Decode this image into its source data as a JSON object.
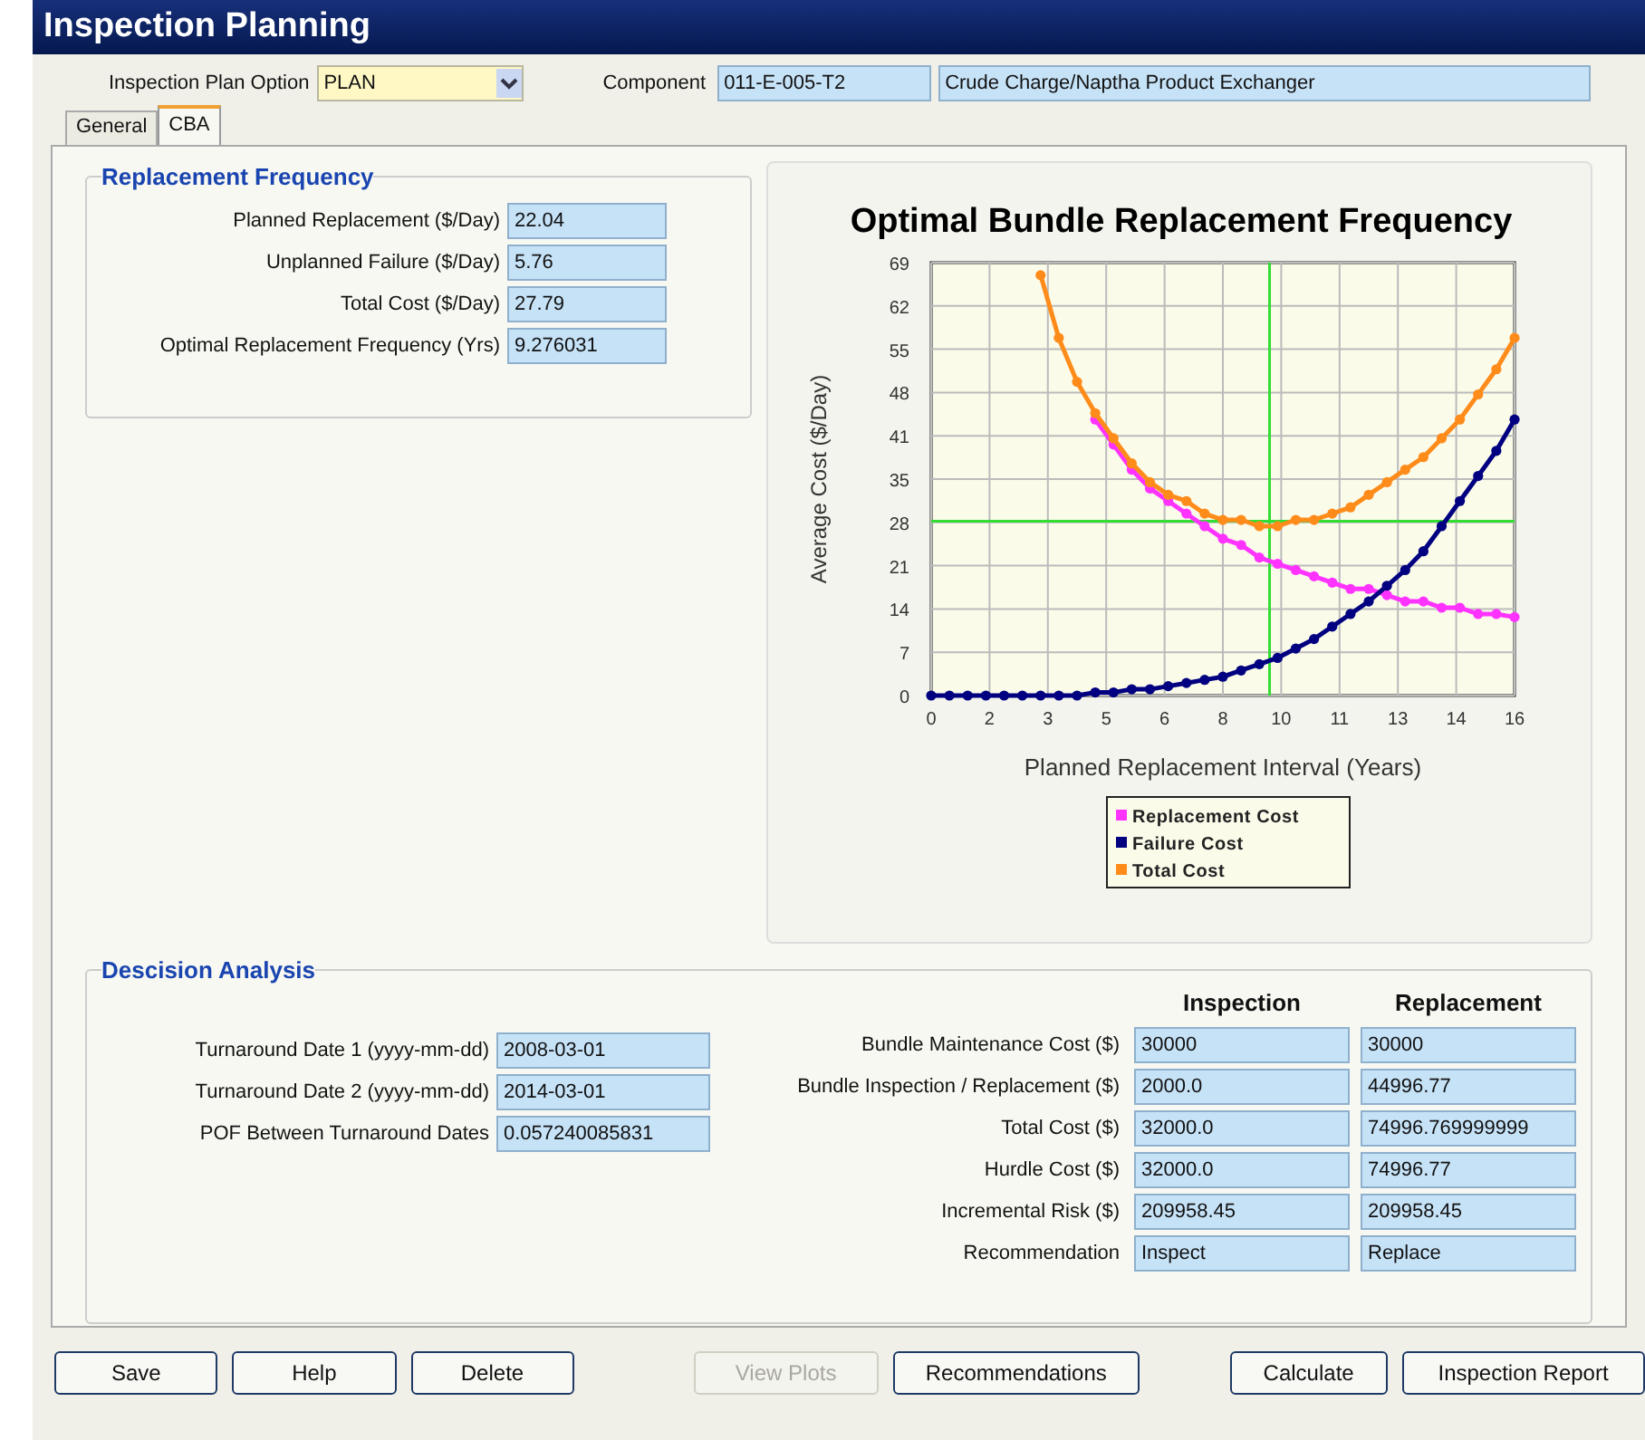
{
  "window": {
    "title": "Inspection Planning"
  },
  "header": {
    "plan_option": {
      "label": "Inspection Plan Option",
      "value": "PLAN"
    },
    "component": {
      "label": "Component",
      "code": "011-E-005-T2",
      "description": "Crude Charge/Naptha Product Exchanger"
    }
  },
  "tabs": [
    {
      "label": "General",
      "selected": false
    },
    {
      "label": "CBA",
      "selected": true
    }
  ],
  "replacement_frequency": {
    "title": "Replacement Frequency",
    "fields": [
      {
        "label": "Planned Replacement ($/Day)",
        "value": "22.04"
      },
      {
        "label": "Unplanned Failure ($/Day)",
        "value": "5.76"
      },
      {
        "label": "Total Cost ($/Day)",
        "value": "27.79"
      },
      {
        "label": "Optimal Replacement Frequency (Yrs)",
        "value": "9.276031"
      }
    ]
  },
  "chart": {
    "chart_data": {
      "type": "line",
      "title": "Optimal Bundle Replacement Frequency",
      "xlabel": "Planned Replacement Interval (Years)",
      "ylabel": "Average Cost ($/Day)",
      "x": [
        0,
        0.5,
        1,
        1.5,
        2,
        2.5,
        3,
        3.5,
        4,
        4.5,
        5,
        5.5,
        6,
        6.5,
        7,
        7.5,
        8,
        8.5,
        9,
        9.5,
        10,
        10.5,
        11,
        11.5,
        12,
        12.5,
        13,
        13.5,
        14,
        14.5,
        15,
        15.5,
        16
      ],
      "series": [
        {
          "name": "Replacement Cost",
          "color": "#ff33ff",
          "marker": "circle",
          "values": [
            null,
            null,
            null,
            null,
            null,
            null,
            null,
            null,
            null,
            44,
            40,
            36,
            33,
            31,
            29,
            27,
            25,
            24,
            22,
            21,
            20,
            19,
            18,
            17,
            17,
            16,
            15,
            15,
            14,
            14,
            13,
            13,
            12.5
          ]
        },
        {
          "name": "Failure Cost",
          "color": "#000080",
          "marker": "circle",
          "values": [
            0,
            0,
            0,
            0,
            0,
            0,
            0,
            0,
            0,
            0.5,
            0.5,
            1,
            1,
            1.5,
            2,
            2.5,
            3,
            4,
            5,
            6,
            7.5,
            9,
            11,
            13,
            15,
            17.5,
            20,
            23,
            27,
            31,
            35,
            39,
            44
          ]
        },
        {
          "name": "Total Cost",
          "color": "#ff8c1a",
          "marker": "circle",
          "values": [
            null,
            null,
            null,
            null,
            null,
            null,
            67,
            57,
            50,
            45,
            41,
            37,
            34,
            32,
            31,
            29,
            28,
            28,
            27,
            27,
            28,
            28,
            29,
            30,
            32,
            34,
            36,
            38,
            41,
            44,
            48,
            52,
            57
          ]
        }
      ],
      "xlim": [
        0,
        16
      ],
      "ylim": [
        0,
        69
      ],
      "xticks": [
        {
          "value": 0,
          "label": "0"
        },
        {
          "value": 1.6,
          "label": "2"
        },
        {
          "value": 3.2,
          "label": "3"
        },
        {
          "value": 4.8,
          "label": "5"
        },
        {
          "value": 6.4,
          "label": "6"
        },
        {
          "value": 8,
          "label": "8"
        },
        {
          "value": 9.6,
          "label": "10"
        },
        {
          "value": 11.2,
          "label": "11"
        },
        {
          "value": 12.8,
          "label": "13"
        },
        {
          "value": 14.4,
          "label": "14"
        },
        {
          "value": 16,
          "label": "16"
        }
      ],
      "yticks": [
        {
          "value": 0,
          "label": "0"
        },
        {
          "value": 6.9,
          "label": "7"
        },
        {
          "value": 13.8,
          "label": "14"
        },
        {
          "value": 20.7,
          "label": "21"
        },
        {
          "value": 27.6,
          "label": "28"
        },
        {
          "value": 34.5,
          "label": "35"
        },
        {
          "value": 41.4,
          "label": "41"
        },
        {
          "value": 48.3,
          "label": "48"
        },
        {
          "value": 55.2,
          "label": "55"
        },
        {
          "value": 62.1,
          "label": "62"
        },
        {
          "value": 69,
          "label": "69"
        }
      ],
      "grid": true,
      "legend": true,
      "ref_lines": [
        {
          "axis": "x",
          "value": 9.28
        },
        {
          "axis": "y",
          "value": 27.79
        }
      ]
    }
  },
  "decision_analysis": {
    "title": "Descision Analysis",
    "left_fields": [
      {
        "label": "Turnaround Date 1 (yyyy-mm-dd)",
        "value": "2008-03-01"
      },
      {
        "label": "Turnaround Date 2 (yyyy-mm-dd)",
        "value": "2014-03-01"
      },
      {
        "label": "POF Between Turnaround Dates",
        "value": "0.057240085831"
      }
    ],
    "columns": [
      "Inspection",
      "Replacement"
    ],
    "rows": [
      {
        "label": "Bundle Maintenance Cost ($)",
        "values": [
          "30000",
          "30000"
        ]
      },
      {
        "label": "Bundle Inspection / Replacement ($)",
        "values": [
          "2000.0",
          "44996.77"
        ]
      },
      {
        "label": "Total Cost ($)",
        "values": [
          "32000.0",
          "74996.769999999"
        ]
      },
      {
        "label": "Hurdle Cost ($)",
        "values": [
          "32000.0",
          "74996.77"
        ]
      },
      {
        "label": "Incremental Risk ($)",
        "values": [
          "209958.45",
          "209958.45"
        ]
      },
      {
        "label": "Recommendation",
        "values": [
          "Inspect",
          "Replace"
        ]
      }
    ]
  },
  "buttons": [
    {
      "label": "Save",
      "disabled": false
    },
    {
      "label": "Help",
      "disabled": false
    },
    {
      "label": "Delete",
      "disabled": false
    },
    {
      "label": "View Plots",
      "disabled": true
    },
    {
      "label": "Recommendations",
      "disabled": false
    },
    {
      "label": "Calculate",
      "disabled": false
    },
    {
      "label": "Inspection Report",
      "disabled": false
    }
  ]
}
